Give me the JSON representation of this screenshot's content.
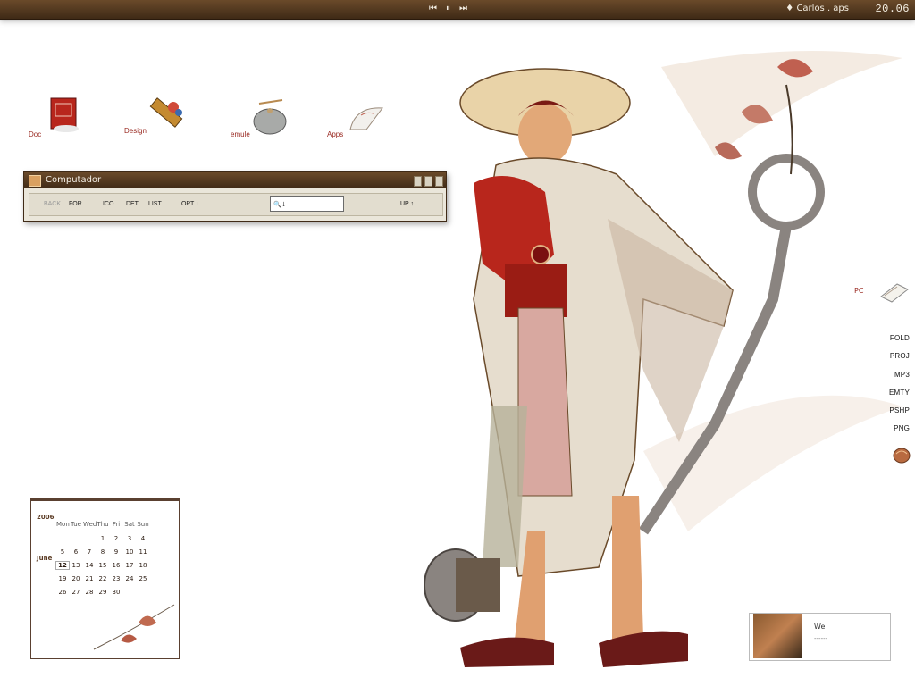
{
  "topbar": {
    "media": {
      "prev_icon": "⏮",
      "pause_icon": "⏸",
      "next_icon": "⏭"
    },
    "user": "♦ Carlos . aps",
    "clock": "20.06"
  },
  "desktop_icons": [
    {
      "label": "Doc",
      "icon": "book-icon"
    },
    {
      "label": "Design",
      "icon": "brushes-icon"
    },
    {
      "label": "emule",
      "icon": "teapot-icon"
    },
    {
      "label": "Apps",
      "icon": "fan-icon"
    }
  ],
  "window": {
    "title": "Computador",
    "toolbar": {
      "back": ".BACK",
      "for": ".FOR",
      "ico": ".ICO",
      "det": ".DET",
      "list": ".LIST",
      "opt": ".OPT ↓",
      "search_value": "🔍↓",
      "up": ".UP ↑"
    }
  },
  "dock": {
    "pc_label": "PC",
    "items": [
      "FOLD",
      "PROJ",
      "MP3",
      "EMTY",
      "PSHP",
      "PNG"
    ]
  },
  "calendar": {
    "year": "2006",
    "month": "June",
    "weekdays": [
      "Mon",
      "Tue",
      "Wed",
      "Thu",
      "Fri",
      "Sat",
      "Sun"
    ],
    "weeks": [
      [
        "",
        "",
        "",
        "1",
        "2",
        "3",
        "4"
      ],
      [
        "5",
        "6",
        "7",
        "8",
        "9",
        "10",
        "11"
      ],
      [
        "12",
        "13",
        "14",
        "15",
        "16",
        "17",
        "18"
      ],
      [
        "19",
        "20",
        "21",
        "22",
        "23",
        "24",
        "25"
      ],
      [
        "26",
        "27",
        "28",
        "29",
        "30",
        "",
        ""
      ]
    ],
    "today": "12"
  },
  "photo_widget": {
    "name": "We",
    "sub": "------"
  },
  "colors": {
    "bar_top": "#6a4a2a",
    "bar_bottom": "#3f2a16",
    "label_red": "#9a2a22",
    "window_bg": "#eae6da"
  }
}
